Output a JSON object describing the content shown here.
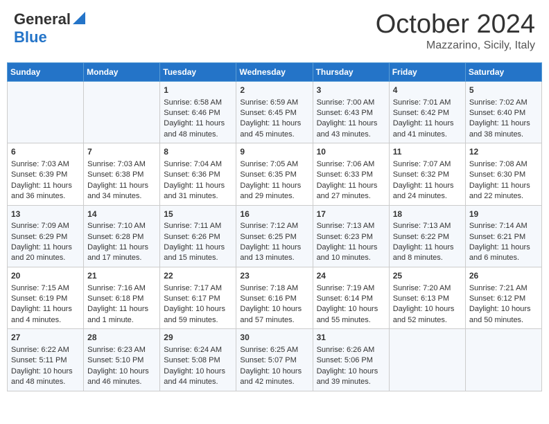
{
  "header": {
    "logo_line1": "General",
    "logo_line2": "Blue",
    "month": "October 2024",
    "location": "Mazzarino, Sicily, Italy"
  },
  "weekdays": [
    "Sunday",
    "Monday",
    "Tuesday",
    "Wednesday",
    "Thursday",
    "Friday",
    "Saturday"
  ],
  "weeks": [
    [
      {
        "day": "",
        "sunrise": "",
        "sunset": "",
        "daylight": ""
      },
      {
        "day": "",
        "sunrise": "",
        "sunset": "",
        "daylight": ""
      },
      {
        "day": "1",
        "sunrise": "Sunrise: 6:58 AM",
        "sunset": "Sunset: 6:46 PM",
        "daylight": "Daylight: 11 hours and 48 minutes."
      },
      {
        "day": "2",
        "sunrise": "Sunrise: 6:59 AM",
        "sunset": "Sunset: 6:45 PM",
        "daylight": "Daylight: 11 hours and 45 minutes."
      },
      {
        "day": "3",
        "sunrise": "Sunrise: 7:00 AM",
        "sunset": "Sunset: 6:43 PM",
        "daylight": "Daylight: 11 hours and 43 minutes."
      },
      {
        "day": "4",
        "sunrise": "Sunrise: 7:01 AM",
        "sunset": "Sunset: 6:42 PM",
        "daylight": "Daylight: 11 hours and 41 minutes."
      },
      {
        "day": "5",
        "sunrise": "Sunrise: 7:02 AM",
        "sunset": "Sunset: 6:40 PM",
        "daylight": "Daylight: 11 hours and 38 minutes."
      }
    ],
    [
      {
        "day": "6",
        "sunrise": "Sunrise: 7:03 AM",
        "sunset": "Sunset: 6:39 PM",
        "daylight": "Daylight: 11 hours and 36 minutes."
      },
      {
        "day": "7",
        "sunrise": "Sunrise: 7:03 AM",
        "sunset": "Sunset: 6:38 PM",
        "daylight": "Daylight: 11 hours and 34 minutes."
      },
      {
        "day": "8",
        "sunrise": "Sunrise: 7:04 AM",
        "sunset": "Sunset: 6:36 PM",
        "daylight": "Daylight: 11 hours and 31 minutes."
      },
      {
        "day": "9",
        "sunrise": "Sunrise: 7:05 AM",
        "sunset": "Sunset: 6:35 PM",
        "daylight": "Daylight: 11 hours and 29 minutes."
      },
      {
        "day": "10",
        "sunrise": "Sunrise: 7:06 AM",
        "sunset": "Sunset: 6:33 PM",
        "daylight": "Daylight: 11 hours and 27 minutes."
      },
      {
        "day": "11",
        "sunrise": "Sunrise: 7:07 AM",
        "sunset": "Sunset: 6:32 PM",
        "daylight": "Daylight: 11 hours and 24 minutes."
      },
      {
        "day": "12",
        "sunrise": "Sunrise: 7:08 AM",
        "sunset": "Sunset: 6:30 PM",
        "daylight": "Daylight: 11 hours and 22 minutes."
      }
    ],
    [
      {
        "day": "13",
        "sunrise": "Sunrise: 7:09 AM",
        "sunset": "Sunset: 6:29 PM",
        "daylight": "Daylight: 11 hours and 20 minutes."
      },
      {
        "day": "14",
        "sunrise": "Sunrise: 7:10 AM",
        "sunset": "Sunset: 6:28 PM",
        "daylight": "Daylight: 11 hours and 17 minutes."
      },
      {
        "day": "15",
        "sunrise": "Sunrise: 7:11 AM",
        "sunset": "Sunset: 6:26 PM",
        "daylight": "Daylight: 11 hours and 15 minutes."
      },
      {
        "day": "16",
        "sunrise": "Sunrise: 7:12 AM",
        "sunset": "Sunset: 6:25 PM",
        "daylight": "Daylight: 11 hours and 13 minutes."
      },
      {
        "day": "17",
        "sunrise": "Sunrise: 7:13 AM",
        "sunset": "Sunset: 6:23 PM",
        "daylight": "Daylight: 11 hours and 10 minutes."
      },
      {
        "day": "18",
        "sunrise": "Sunrise: 7:13 AM",
        "sunset": "Sunset: 6:22 PM",
        "daylight": "Daylight: 11 hours and 8 minutes."
      },
      {
        "day": "19",
        "sunrise": "Sunrise: 7:14 AM",
        "sunset": "Sunset: 6:21 PM",
        "daylight": "Daylight: 11 hours and 6 minutes."
      }
    ],
    [
      {
        "day": "20",
        "sunrise": "Sunrise: 7:15 AM",
        "sunset": "Sunset: 6:19 PM",
        "daylight": "Daylight: 11 hours and 4 minutes."
      },
      {
        "day": "21",
        "sunrise": "Sunrise: 7:16 AM",
        "sunset": "Sunset: 6:18 PM",
        "daylight": "Daylight: 11 hours and 1 minute."
      },
      {
        "day": "22",
        "sunrise": "Sunrise: 7:17 AM",
        "sunset": "Sunset: 6:17 PM",
        "daylight": "Daylight: 10 hours and 59 minutes."
      },
      {
        "day": "23",
        "sunrise": "Sunrise: 7:18 AM",
        "sunset": "Sunset: 6:16 PM",
        "daylight": "Daylight: 10 hours and 57 minutes."
      },
      {
        "day": "24",
        "sunrise": "Sunrise: 7:19 AM",
        "sunset": "Sunset: 6:14 PM",
        "daylight": "Daylight: 10 hours and 55 minutes."
      },
      {
        "day": "25",
        "sunrise": "Sunrise: 7:20 AM",
        "sunset": "Sunset: 6:13 PM",
        "daylight": "Daylight: 10 hours and 52 minutes."
      },
      {
        "day": "26",
        "sunrise": "Sunrise: 7:21 AM",
        "sunset": "Sunset: 6:12 PM",
        "daylight": "Daylight: 10 hours and 50 minutes."
      }
    ],
    [
      {
        "day": "27",
        "sunrise": "Sunrise: 6:22 AM",
        "sunset": "Sunset: 5:11 PM",
        "daylight": "Daylight: 10 hours and 48 minutes."
      },
      {
        "day": "28",
        "sunrise": "Sunrise: 6:23 AM",
        "sunset": "Sunset: 5:10 PM",
        "daylight": "Daylight: 10 hours and 46 minutes."
      },
      {
        "day": "29",
        "sunrise": "Sunrise: 6:24 AM",
        "sunset": "Sunset: 5:08 PM",
        "daylight": "Daylight: 10 hours and 44 minutes."
      },
      {
        "day": "30",
        "sunrise": "Sunrise: 6:25 AM",
        "sunset": "Sunset: 5:07 PM",
        "daylight": "Daylight: 10 hours and 42 minutes."
      },
      {
        "day": "31",
        "sunrise": "Sunrise: 6:26 AM",
        "sunset": "Sunset: 5:06 PM",
        "daylight": "Daylight: 10 hours and 39 minutes."
      },
      {
        "day": "",
        "sunrise": "",
        "sunset": "",
        "daylight": ""
      },
      {
        "day": "",
        "sunrise": "",
        "sunset": "",
        "daylight": ""
      }
    ]
  ]
}
